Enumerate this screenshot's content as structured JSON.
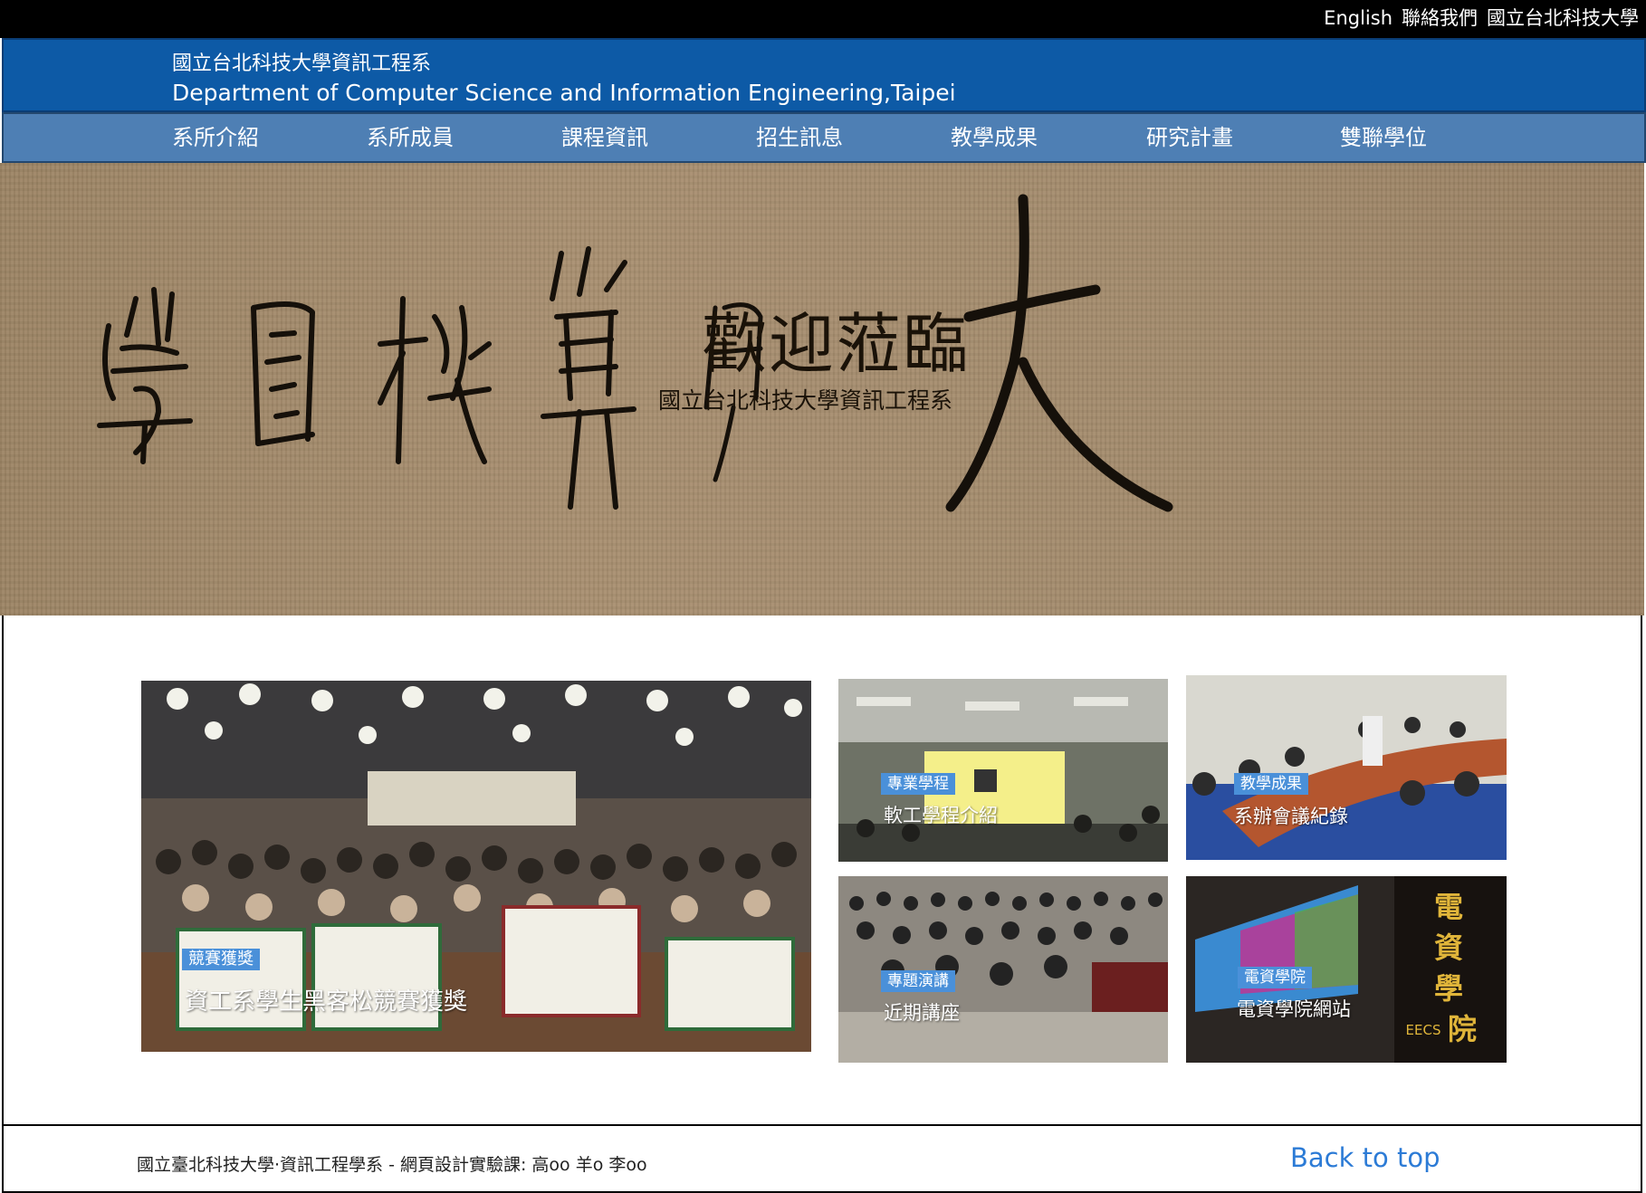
{
  "topbar": {
    "links": [
      "English",
      "聯絡我們",
      "國立台北科技大學"
    ]
  },
  "header": {
    "title_zh": "國立台北科技大學資訊工程系",
    "title_en": "Department of Computer Science and Information Engineering,Taipei"
  },
  "nav": {
    "items": [
      "系所介紹",
      "系所成員",
      "課程資訊",
      "招生訊息",
      "教學成果",
      "研究計畫",
      "雙聯學位"
    ]
  },
  "hero": {
    "welcome": "歡迎蒞臨",
    "subtitle": "國立台北科技大學資訊工程系"
  },
  "tiles": [
    {
      "badge": "競賽獲獎",
      "caption": "資工系學生黑客松競賽獲獎"
    },
    {
      "badge": "專業學程",
      "caption": "軟工學程介紹"
    },
    {
      "badge": "教學成果",
      "caption": "系辦會議紀錄"
    },
    {
      "badge": "專題演講",
      "caption": "近期講座"
    },
    {
      "badge": "電資學院",
      "caption": "電資學院網站"
    }
  ],
  "footer": {
    "credit": "國立臺北科技大學‧資訊工程學系 - 網頁設計實驗課: 高oo 羊o 李oo",
    "back_to_top": "Back to top"
  },
  "colors": {
    "topbar": "#000000",
    "header": "#0d5aa6",
    "nav": "#4e7fb4",
    "badge": "#4a90d9",
    "link": "#2c7bd6"
  }
}
